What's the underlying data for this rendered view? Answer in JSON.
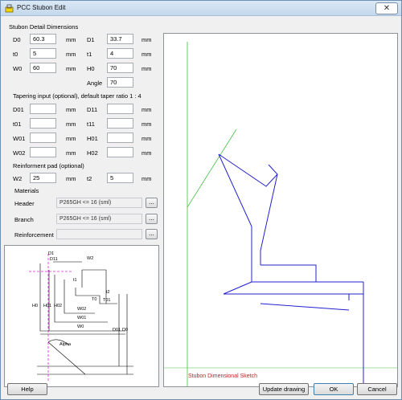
{
  "window": {
    "title": "PCC Stubon Edit",
    "close_glyph": "✕"
  },
  "detail": {
    "heading": "Stubon Detail Dimensions",
    "fields": [
      {
        "label": "D0",
        "value": "60.3",
        "unit": "mm"
      },
      {
        "label": "D1",
        "value": "33.7",
        "unit": "mm"
      },
      {
        "label": "t0",
        "value": "5",
        "unit": "mm"
      },
      {
        "label": "t1",
        "value": "4",
        "unit": "mm"
      },
      {
        "label": "W0",
        "value": "60",
        "unit": "mm"
      },
      {
        "label": "H0",
        "value": "70",
        "unit": "mm"
      },
      {
        "label": "Angle",
        "value": "70"
      }
    ]
  },
  "taper": {
    "heading": "Tapering input (optional), default taper ratio 1 : 4",
    "fields": [
      {
        "label": "D01",
        "value": "",
        "unit": "mm"
      },
      {
        "label": "D11",
        "value": "",
        "unit": "mm"
      },
      {
        "label": "t01",
        "value": "",
        "unit": "mm"
      },
      {
        "label": "t11",
        "value": "",
        "unit": "mm"
      },
      {
        "label": "W01",
        "value": "",
        "unit": "mm"
      },
      {
        "label": "H01",
        "value": "",
        "unit": "mm"
      },
      {
        "label": "W02",
        "value": "",
        "unit": "mm"
      },
      {
        "label": "H02",
        "value": "",
        "unit": "mm"
      }
    ]
  },
  "pad": {
    "heading": "Reinforment pad (optional)",
    "fields": [
      {
        "label": "W2",
        "value": "25",
        "unit": "mm"
      },
      {
        "label": "t2",
        "value": "5",
        "unit": "mm"
      }
    ]
  },
  "materials": {
    "heading": "Materials",
    "rows": [
      {
        "label": "Header",
        "value": "P265GH <= 16 (sml)",
        "button": "..."
      },
      {
        "label": "Branch",
        "value": "P265GH <= 16 (sml)",
        "button": "..."
      },
      {
        "label": "Reinforcement",
        "value": "",
        "button": "..."
      }
    ]
  },
  "sketch_labels": {
    "d1": "D1",
    "d11": "D11",
    "w2": "W2",
    "t1": "t1",
    "t2": "t2",
    "t0": "T0",
    "t01": "T01",
    "h0": "H0",
    "h01": "H01",
    "h02": "H02",
    "w02": "W02",
    "w01": "W01",
    "w0": "W0",
    "d01": "D01",
    "d0": "D0",
    "alpha": "Alpha"
  },
  "canvas": {
    "caption": "Stubon Dimensional Sketch"
  },
  "colors": {
    "drawing": "#2020d0",
    "centerline": "#44c044",
    "caption": "#c02020",
    "hatch": "#e020e0"
  },
  "buttons": {
    "help": "Help",
    "update": "Update drawing",
    "ok": "OK",
    "cancel": "Cancel"
  }
}
